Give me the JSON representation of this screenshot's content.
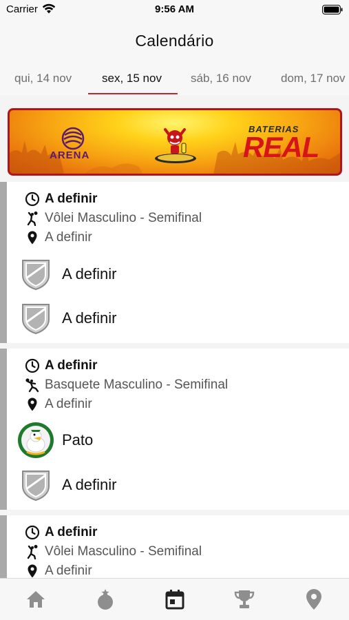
{
  "status_bar": {
    "carrier": "Carrier",
    "time": "9:56 AM"
  },
  "header": {
    "title": "Calendário"
  },
  "date_tabs": [
    {
      "label": "qui, 14 nov",
      "active": false
    },
    {
      "label": "sex, 15 nov",
      "active": true
    },
    {
      "label": "sáb, 16 nov",
      "active": false
    },
    {
      "label": "dom, 17 nov",
      "active": false
    }
  ],
  "banner": {
    "left_brand": "ARENA",
    "right_brand_top": "BATERIAS",
    "right_brand_main": "REAL"
  },
  "events": [
    {
      "time": "A definir",
      "sport": "Vôlei Masculino - Semifinal",
      "sport_icon": "volleyball-player-icon",
      "location": "A definir",
      "teams": [
        {
          "name": "A definir",
          "logo": "shield-placeholder-icon"
        },
        {
          "name": "A definir",
          "logo": "shield-placeholder-icon"
        }
      ]
    },
    {
      "time": "A definir",
      "sport": "Basquete Masculino - Semifinal",
      "sport_icon": "basketball-player-icon",
      "location": "A definir",
      "teams": [
        {
          "name": "Pato",
          "logo": "pato-team-logo"
        },
        {
          "name": "A definir",
          "logo": "shield-placeholder-icon"
        }
      ]
    },
    {
      "time": "A definir",
      "sport": "Vôlei Masculino - Semifinal",
      "sport_icon": "volleyball-player-icon",
      "location": "A definir",
      "teams": []
    }
  ],
  "tab_bar": [
    {
      "icon": "home-icon",
      "active": false
    },
    {
      "icon": "medal-icon",
      "active": false
    },
    {
      "icon": "calendar-icon",
      "active": true
    },
    {
      "icon": "trophy-icon",
      "active": false
    },
    {
      "icon": "map-pin-icon",
      "active": false
    }
  ],
  "colors": {
    "accent": "#c0282d",
    "card_border": "#a9a9a9",
    "inactive_icon": "#8e8e8e",
    "active_icon": "#222222"
  }
}
